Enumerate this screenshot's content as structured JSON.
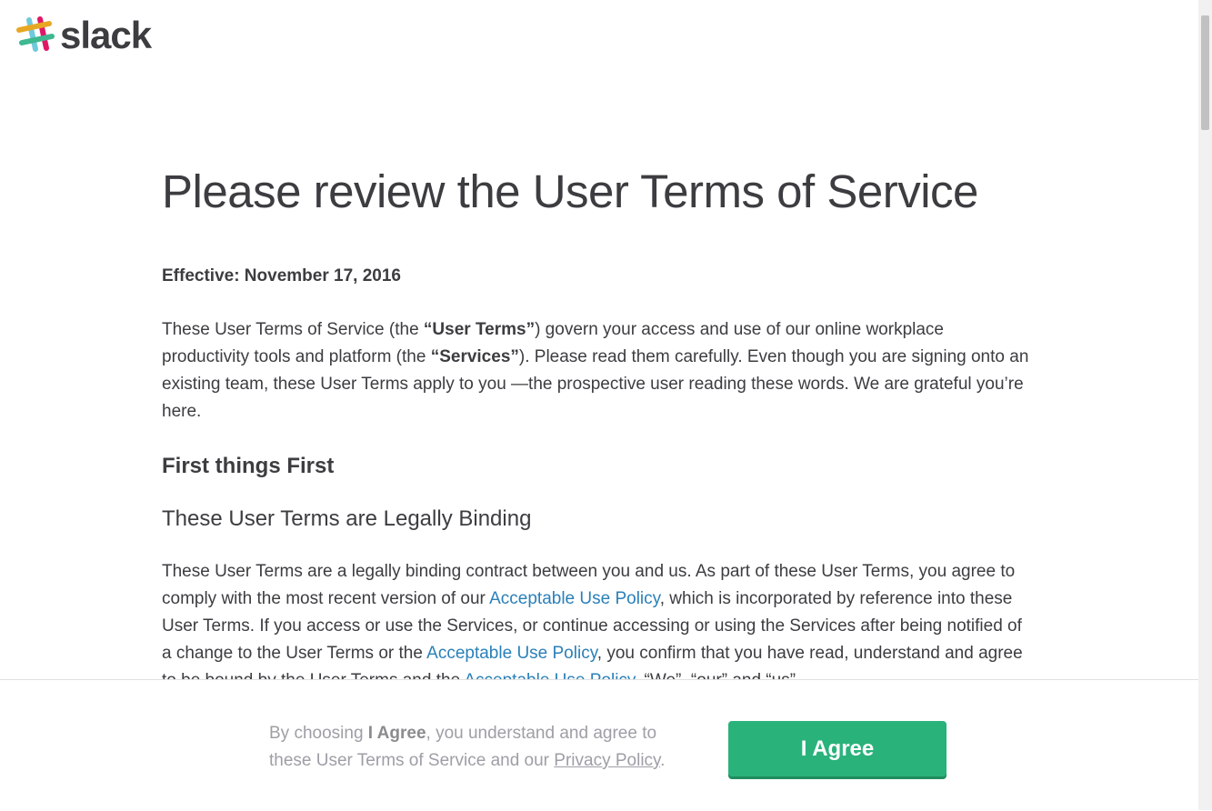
{
  "brand": {
    "name": "slack"
  },
  "page": {
    "title": "Please review the User Terms of Service",
    "effective": "Effective: November 17, 2016",
    "intro": {
      "t1": "These User Terms of Service (the ",
      "b1": "“User Terms”",
      "t2": ") govern your access and use of our online workplace productivity tools and platform (the ",
      "b2": "“Services”",
      "t3": "). Please read them carefully. Even though you are signing onto an existing team, these User Terms apply to you —the prospective user reading these words. We are grateful you’re here."
    },
    "section_heading": "First things First",
    "subsection_heading": "These User Terms are Legally Binding",
    "binding": {
      "t1": "These User Terms are a legally binding contract between you and us. As part of these User Terms, you agree to comply with the most recent version of our ",
      "link1": "Acceptable Use Policy",
      "t2": ", which is incorporated by reference into these User Terms. If you access or use the Services, or continue accessing or using the Services after being notified of a change to the User Terms or the ",
      "link2": "Acceptable Use Policy",
      "t3": ", you confirm that you have read, understand and agree to be bound by the User Terms and the ",
      "link3": "Acceptable Use Policy",
      "t4": ". “We”, “our” and “us”"
    }
  },
  "footer": {
    "t1": "By choosing ",
    "bold": "I Agree",
    "t2": ", you understand and agree to these User Terms of Service and our ",
    "privacy_link": "Privacy Policy",
    "t3": ".",
    "button": "I Agree"
  },
  "colors": {
    "brand_green": "#2ab27b",
    "link_blue": "#2a80b9",
    "text": "#3d3c40",
    "muted": "#9e9ea6"
  }
}
